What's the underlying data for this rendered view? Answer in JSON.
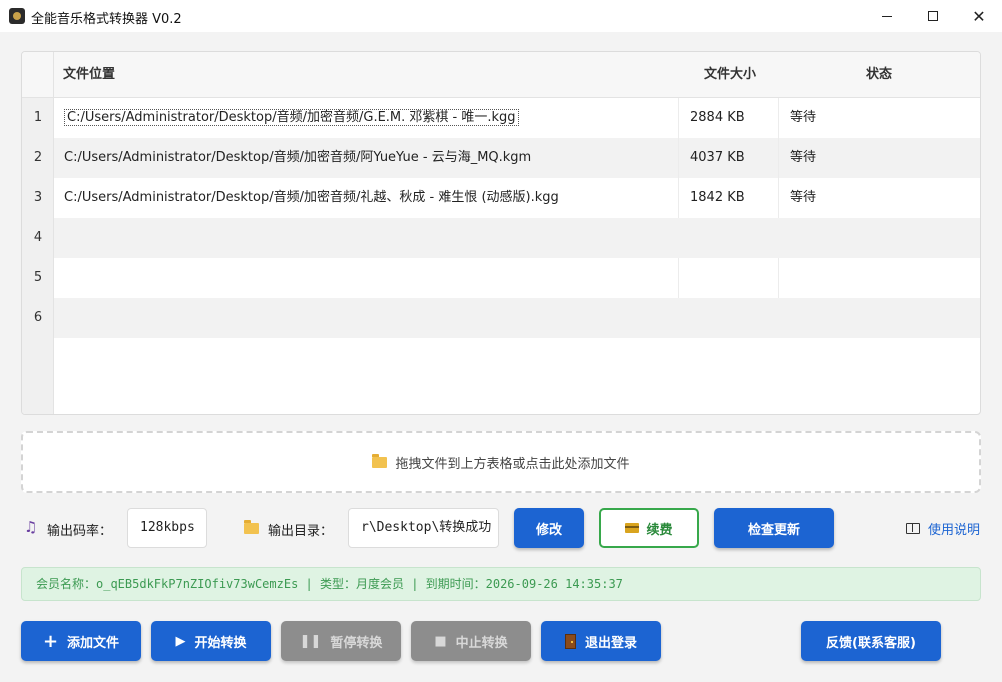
{
  "window": {
    "title": "全能音乐格式转换器 V0.2"
  },
  "table": {
    "columns": [
      "文件位置",
      "文件大小",
      "状态"
    ],
    "row_numbers": [
      "1",
      "2",
      "3",
      "4",
      "5",
      "6"
    ],
    "rows": [
      {
        "path": "C:/Users/Administrator/Desktop/音频/加密音频/G.E.M. 邓紫棋 - 唯一.kgg",
        "size": "2884 KB",
        "status": "等待"
      },
      {
        "path": "C:/Users/Administrator/Desktop/音频/加密音频/阿YueYue - 云与海_MQ.kgm",
        "size": "4037 KB",
        "status": "等待"
      },
      {
        "path": "C:/Users/Administrator/Desktop/音频/加密音频/礼越、秋成 - 难生恨 (动感版).kgg",
        "size": "1842 KB",
        "status": "等待"
      },
      {
        "path": "",
        "size": "",
        "status": ""
      },
      {
        "path": "",
        "size": "",
        "status": ""
      },
      {
        "path": "",
        "size": "",
        "status": ""
      }
    ]
  },
  "dropzone": {
    "text": "拖拽文件到上方表格或点击此处添加文件",
    "icon": "folder-icon"
  },
  "settings": {
    "bitrate_label": "输出码率：",
    "bitrate_value": "128kbps",
    "output_dir_label": "输出目录：",
    "output_dir_value": "r\\Desktop\\转换成功",
    "modify_label": "修改",
    "renew_label": "续费",
    "check_update_label": "检查更新",
    "help_label": "使用说明"
  },
  "member": {
    "text": "会员名称：o_qEB5dkFkP7nZIOfiv73wCemzEs | 类型：月度会员 | 到期时间：2026-09-26 14:35:37"
  },
  "actions": {
    "add_file": "添加文件",
    "start": "开始转换",
    "pause": "暂停转换",
    "stop": "中止转换",
    "logout": "退出登录",
    "feedback": "反馈(联系客服)"
  },
  "colors": {
    "primary_button": "#1c64d2",
    "disabled_button": "#8d8d8d",
    "member_bar_bg": "#dff3e3",
    "member_text": "#3c9a52",
    "renew_border": "#37a84b"
  }
}
